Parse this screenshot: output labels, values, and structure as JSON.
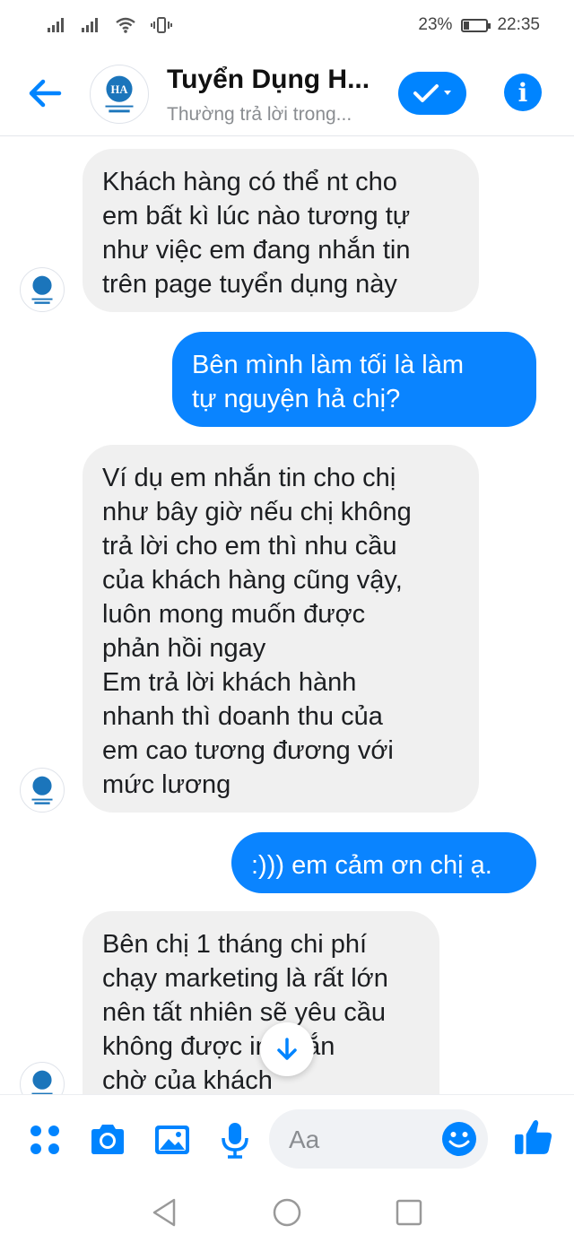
{
  "status_bar": {
    "battery_percent": "23%",
    "time": "22:35"
  },
  "header": {
    "title": "Tuyển Dụng H...",
    "subtitle": "Thường trả lời trong...",
    "avatar_text": "HA"
  },
  "messages": [
    {
      "direction": "incoming",
      "lines": [
        "Khách hàng có thể nt cho",
        "em bất kì lúc nào tương tự",
        "như việc em đang nhắn tin",
        "trên page tuyển dụng này"
      ]
    },
    {
      "direction": "outgoing",
      "lines": [
        "Bên mình làm tối là làm",
        "tự nguyện hả chị?"
      ]
    },
    {
      "direction": "incoming",
      "lines": [
        "Ví dụ em nhắn tin cho chị",
        "như bây giờ nếu chị không",
        "trả lời cho em thì nhu cầu",
        "của khách hàng cũng vậy,",
        "luôn mong muốn được",
        "phản hồi ngay",
        "Em trả lời khách hành",
        "nhanh thì doanh thu của",
        "em cao tương đương với",
        "mức lương"
      ]
    },
    {
      "direction": "outgoing",
      "lines": [
        ":))) em cảm ơn chị ạ."
      ]
    },
    {
      "direction": "incoming",
      "lines": [
        "Bên chị 1 tháng chi phí",
        "chạy marketing là rất lớn",
        "nên tất nhiên sẽ yêu cầu",
        "không được      in nhắn",
        "chờ của khách"
      ]
    }
  ],
  "composer": {
    "placeholder": "Aa"
  },
  "colors": {
    "messenger_blue": "#0084ff",
    "incoming_bubble": "#f0f0f0",
    "outgoing_bubble": "#0a84ff"
  },
  "icons": {
    "status": [
      "signal-icon",
      "signal-icon",
      "wifi-icon",
      "vibrate-icon",
      "battery-icon"
    ],
    "header": [
      "back-arrow-icon",
      "checkmark-icon",
      "info-icon"
    ],
    "composer": [
      "apps-icon",
      "camera-icon",
      "image-icon",
      "microphone-icon",
      "emoji-icon",
      "thumbs-up-icon"
    ],
    "nav": [
      "nav-back-icon",
      "nav-home-icon",
      "nav-recents-icon"
    ]
  }
}
